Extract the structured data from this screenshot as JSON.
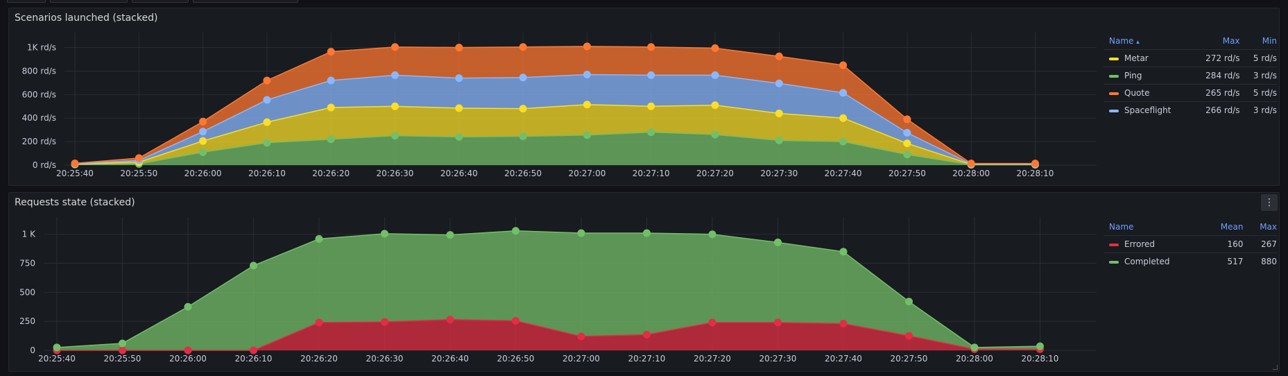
{
  "panels": [
    {
      "title": "Scenarios launched (stacked)",
      "legend_headers": [
        "Name",
        "Max",
        "Min"
      ],
      "legend_sort_indicator": "▴",
      "legend_rows": [
        {
          "name": "Metar",
          "color": "#fade2a",
          "values": [
            "272 rd/s",
            "5 rd/s"
          ]
        },
        {
          "name": "Ping",
          "color": "#73bf69",
          "values": [
            "284 rd/s",
            "3 rd/s"
          ]
        },
        {
          "name": "Quote",
          "color": "#ff7833",
          "values": [
            "265 rd/s",
            "5 rd/s"
          ]
        },
        {
          "name": "Spaceflight",
          "color": "#8ab8ff",
          "values": [
            "266 rd/s",
            "3 rd/s"
          ]
        }
      ]
    },
    {
      "title": "Requests state (stacked)",
      "menu_icon": "kebab-menu-icon",
      "legend_headers": [
        "Name",
        "Mean",
        "Max"
      ],
      "legend_rows": [
        {
          "name": "Errored",
          "color": "#e02f44",
          "values": [
            "160",
            "267"
          ]
        },
        {
          "name": "Completed",
          "color": "#73bf69",
          "values": [
            "517",
            "880"
          ]
        }
      ]
    }
  ],
  "chart_data": [
    {
      "type": "area",
      "title": "Scenarios launched (stacked)",
      "x": [
        "20:25:40",
        "20:25:50",
        "20:26:00",
        "20:26:10",
        "20:26:20",
        "20:26:30",
        "20:26:40",
        "20:26:50",
        "20:27:00",
        "20:27:10",
        "20:27:20",
        "20:27:30",
        "20:27:40",
        "20:27:50",
        "20:28:00",
        "20:28:10"
      ],
      "yticks": [
        "0 rd/s",
        "200 rd/s",
        "400 rd/s",
        "600 rd/s",
        "800 rd/s",
        "1K rd/s"
      ],
      "ylim": [
        0,
        1080
      ],
      "stacked": true,
      "series": [
        {
          "name": "Ping",
          "color": "#73bf69",
          "values": [
            5,
            10,
            110,
            190,
            220,
            250,
            240,
            245,
            255,
            280,
            260,
            210,
            200,
            90,
            3,
            3
          ]
        },
        {
          "name": "Metar",
          "color": "#fade2a",
          "values": [
            3,
            15,
            95,
            175,
            270,
            250,
            245,
            235,
            260,
            220,
            250,
            230,
            200,
            95,
            3,
            3
          ]
        },
        {
          "name": "Spaceflight",
          "color": "#8ab8ff",
          "values": [
            3,
            15,
            80,
            190,
            230,
            265,
            255,
            265,
            255,
            265,
            255,
            255,
            215,
            90,
            3,
            3
          ]
        },
        {
          "name": "Quote",
          "color": "#ff7833",
          "values": [
            4,
            20,
            85,
            165,
            245,
            240,
            260,
            260,
            240,
            240,
            230,
            230,
            235,
            115,
            5,
            5
          ]
        }
      ]
    },
    {
      "type": "area",
      "title": "Requests state (stacked)",
      "x": [
        "20:25:40",
        "20:25:50",
        "20:26:00",
        "20:26:10",
        "20:26:20",
        "20:26:30",
        "20:26:40",
        "20:26:50",
        "20:27:00",
        "20:27:10",
        "20:27:20",
        "20:27:30",
        "20:27:40",
        "20:27:50",
        "20:28:00",
        "20:28:10"
      ],
      "yticks": [
        "0",
        "250",
        "500",
        "750",
        "1 K"
      ],
      "ylim": [
        0,
        1100
      ],
      "stacked": true,
      "series": [
        {
          "name": "Errored",
          "color": "#e02f44",
          "values": [
            0,
            0,
            0,
            0,
            240,
            245,
            265,
            255,
            120,
            135,
            240,
            240,
            230,
            125,
            10,
            10
          ]
        },
        {
          "name": "Completed",
          "color": "#73bf69",
          "values": [
            25,
            60,
            375,
            730,
            720,
            760,
            730,
            775,
            890,
            875,
            760,
            690,
            620,
            295,
            15,
            25
          ]
        }
      ]
    }
  ]
}
